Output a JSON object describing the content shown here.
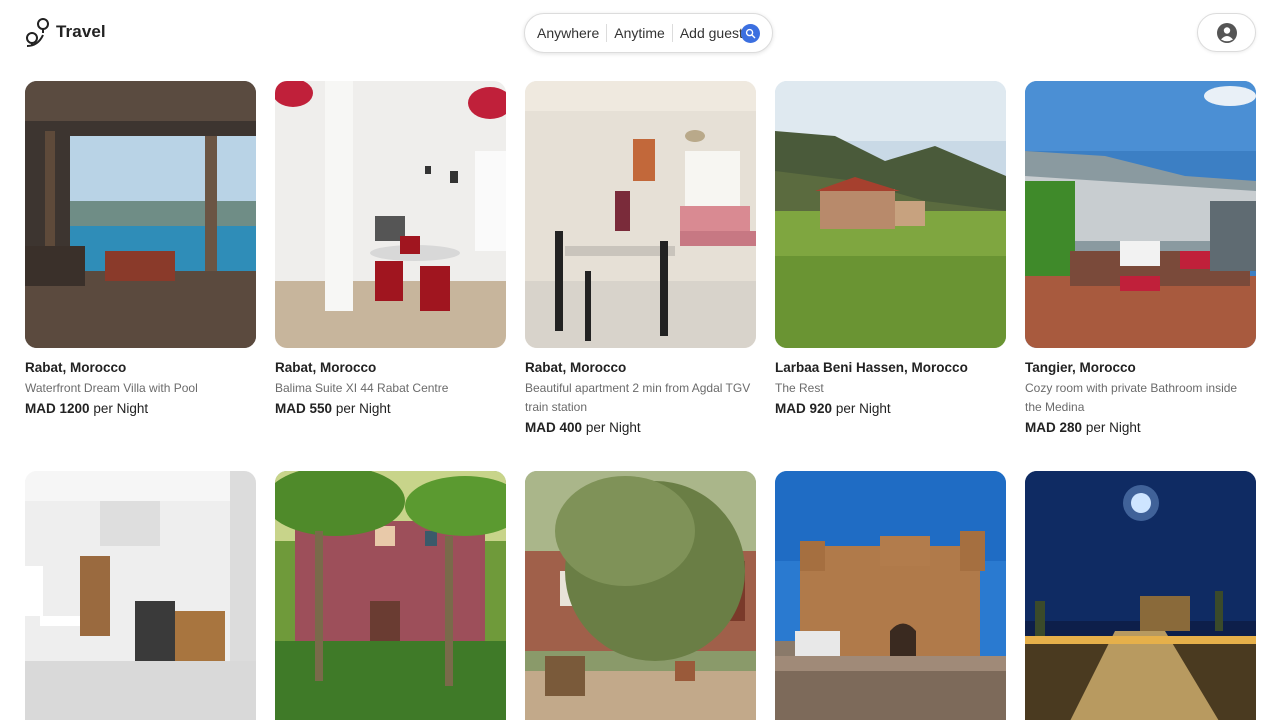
{
  "app": {
    "logo_text": "Travel",
    "logo_icon": "location-pins-icon"
  },
  "search": {
    "where": "Anywhere",
    "when": "Anytime",
    "guests": "Add guests",
    "button_icon": "search-icon",
    "accent": "#3b6fe0"
  },
  "profile": {
    "icon": "user-avatar-icon"
  },
  "listings": [
    {
      "location": "Rabat, Morocco",
      "title": "Waterfront Dream Villa with Pool",
      "currency": "MAD",
      "amount": "1200",
      "unit": "per Night"
    },
    {
      "location": "Rabat, Morocco",
      "title": "Balima Suite XI 44 Rabat Centre",
      "currency": "MAD",
      "amount": "550",
      "unit": "per Night"
    },
    {
      "location": "Rabat, Morocco",
      "title": "Beautiful apartment 2 min from Agdal TGV train station",
      "currency": "MAD",
      "amount": "400",
      "unit": "per Night"
    },
    {
      "location": "Larbaa Beni Hassen, Morocco",
      "title": "The Rest",
      "currency": "MAD",
      "amount": "920",
      "unit": "per Night"
    },
    {
      "location": "Tangier, Morocco",
      "title": "Cozy room with private Bathroom inside the Medina",
      "currency": "MAD",
      "amount": "280",
      "unit": "per Night"
    }
  ]
}
